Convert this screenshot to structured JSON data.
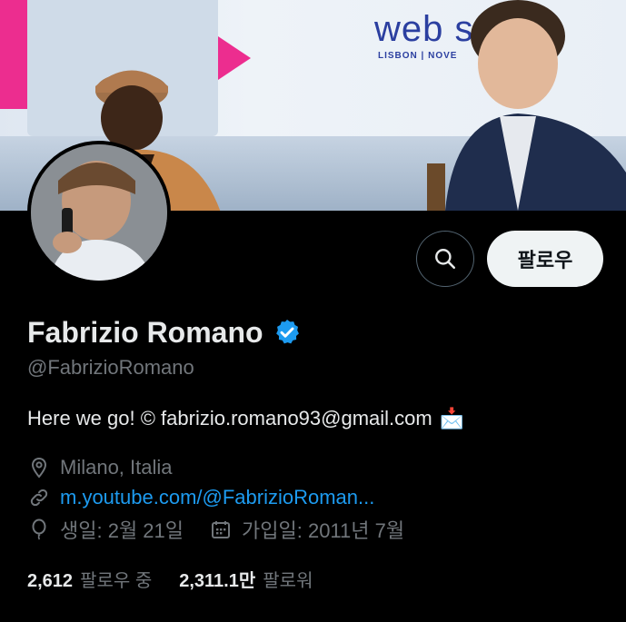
{
  "profile": {
    "name": "Fabrizio Romano",
    "handle": "@FabrizioRomano",
    "bio": "Here we go! © fabrizio.romano93@gmail.com",
    "bio_emoji": "📩",
    "location": "Milano, Italia",
    "website": "m.youtube.com/@FabrizioRoman...",
    "birthday": "생일: 2월 21일",
    "joined": "가입일: 2011년 7월",
    "verified_color": "#1d9bf0"
  },
  "actions": {
    "search_icon": "search-icon",
    "follow_label": "팔로우"
  },
  "stats": {
    "following_count": "2,612",
    "following_label": "팔로우 중",
    "followers_count": "2,311.1만",
    "followers_label": "팔로워"
  },
  "banner": {
    "logo_text": "web s",
    "logo_sub": "LISBON | NOVE"
  }
}
